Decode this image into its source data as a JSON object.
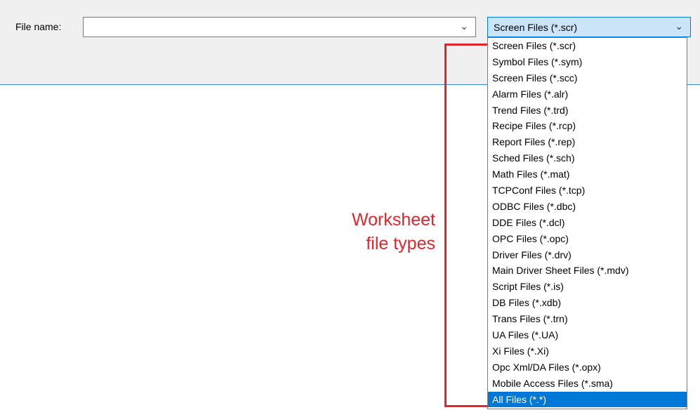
{
  "dialog": {
    "file_name_label": "File name:",
    "file_name_value": "",
    "file_type_selected": "Screen Files (*.scr)"
  },
  "dropdown": {
    "items": [
      "Screen Files (*.scr)",
      "Symbol Files (*.sym)",
      "Screen Files (*.scc)",
      "Alarm Files (*.alr)",
      "Trend Files (*.trd)",
      "Recipe Files (*.rcp)",
      "Report Files (*.rep)",
      "Sched Files (*.sch)",
      "Math Files (*.mat)",
      "TCPConf Files (*.tcp)",
      "ODBC Files (*.dbc)",
      "DDE Files (*.dcl)",
      "OPC Files (*.opc)",
      "Driver Files (*.drv)",
      "Main Driver Sheet Files (*.mdv)",
      "Script Files (*.is)",
      "DB Files (*.xdb)",
      "Trans Files (*.trn)",
      "UA Files (*.UA)",
      "Xi Files (*.Xi)",
      "Opc Xml/DA Files (*.opx)",
      "Mobile Access Files (*.sma)",
      "All Files (*.*)"
    ],
    "highlighted": "All Files (*.*)"
  },
  "annotation": {
    "line1": "Worksheet",
    "line2": "file types",
    "color": "#e3242b"
  },
  "icons": {
    "chevron": "chevron-down-icon"
  },
  "colors": {
    "selection": "#0078d7",
    "combo_focus_bg": "#cce4f7",
    "panel_bg": "#f0f0f0"
  }
}
